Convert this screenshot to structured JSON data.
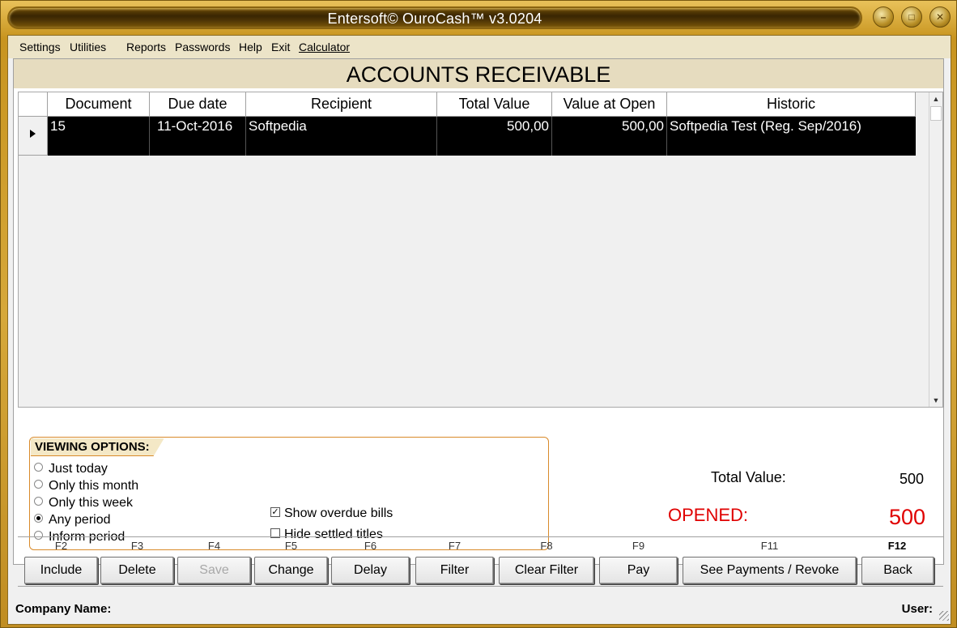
{
  "window": {
    "title": "Entersoft© OuroCash™ v3.0204"
  },
  "menu": [
    "Settings",
    "Utilities",
    "Reports",
    "Passwords",
    "Help",
    "Exit",
    "Calculator"
  ],
  "page_title": "ACCOUNTS RECEIVABLE",
  "grid": {
    "columns": [
      "Document",
      "Due date",
      "Recipient",
      "Total Value",
      "Value at Open",
      "Historic"
    ],
    "rows": [
      [
        "15",
        "11-Oct-2016",
        "Softpedia",
        "500,00",
        "500,00",
        "Softpedia Test (Reg. Sep/2016)"
      ]
    ]
  },
  "viewing_options": {
    "title": "VIEWING OPTIONS:",
    "radios": [
      "Just today",
      "Only this month",
      "Only this week",
      "Any period",
      "Inform period"
    ],
    "selected": "Any period",
    "checkboxes": [
      {
        "label": "Show overdue bills",
        "checked": true
      },
      {
        "label": "Hide settled titles",
        "checked": false
      }
    ]
  },
  "totals": {
    "total_label": "Total Value:",
    "total_value": "500",
    "opened_label": "OPENED:",
    "opened_value": "500",
    "opened_color": "#e00000"
  },
  "buttons": [
    {
      "key": "F2",
      "label": "Include",
      "enabled": true
    },
    {
      "key": "F3",
      "label": "Delete",
      "enabled": true
    },
    {
      "key": "F4",
      "label": "Save",
      "enabled": false
    },
    {
      "key": "F5",
      "label": "Change",
      "enabled": true
    },
    {
      "key": "F6",
      "label": "Delay",
      "enabled": true
    },
    {
      "key": "F7",
      "label": "Filter",
      "enabled": true
    },
    {
      "key": "F8",
      "label": "Clear Filter",
      "enabled": true
    },
    {
      "key": "F9",
      "label": "Pay",
      "enabled": true
    },
    {
      "key": "F11",
      "label": "See Payments / Revoke",
      "enabled": true
    },
    {
      "key": "F12",
      "label": "Back",
      "enabled": true
    }
  ],
  "status": {
    "company_label": "Company Name:",
    "user_label": "User:"
  },
  "colors": {
    "frame_gold": "#c8941f",
    "selected_row": "#000000",
    "accent_orange": "#d98a2a"
  }
}
